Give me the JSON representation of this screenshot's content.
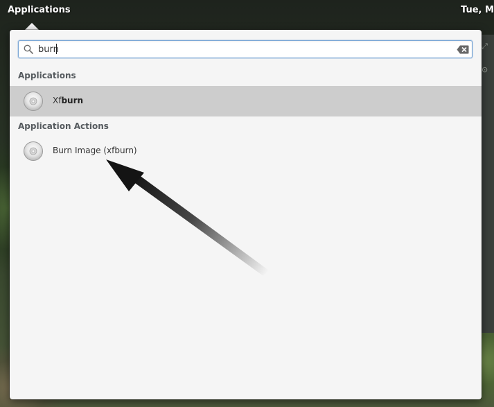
{
  "panel": {
    "apps_label": "Applications",
    "clock": "Tue, Mar"
  },
  "search": {
    "value": "burn",
    "placeholder": ""
  },
  "sections": {
    "applications": "Applications",
    "actions": "Application Actions"
  },
  "results": {
    "app": {
      "prefix": "Xf",
      "match": "burn",
      "icon": "optical-disc-icon",
      "selected": true
    },
    "action": {
      "label": "Burn Image (xfburn)",
      "icon": "optical-disc-icon",
      "selected": false
    }
  },
  "colors": {
    "popover_bg": "#f5f5f5",
    "selected_row": "#cdcdcd",
    "search_focus": "#7aa7d6",
    "section_text": "#555a5e"
  }
}
